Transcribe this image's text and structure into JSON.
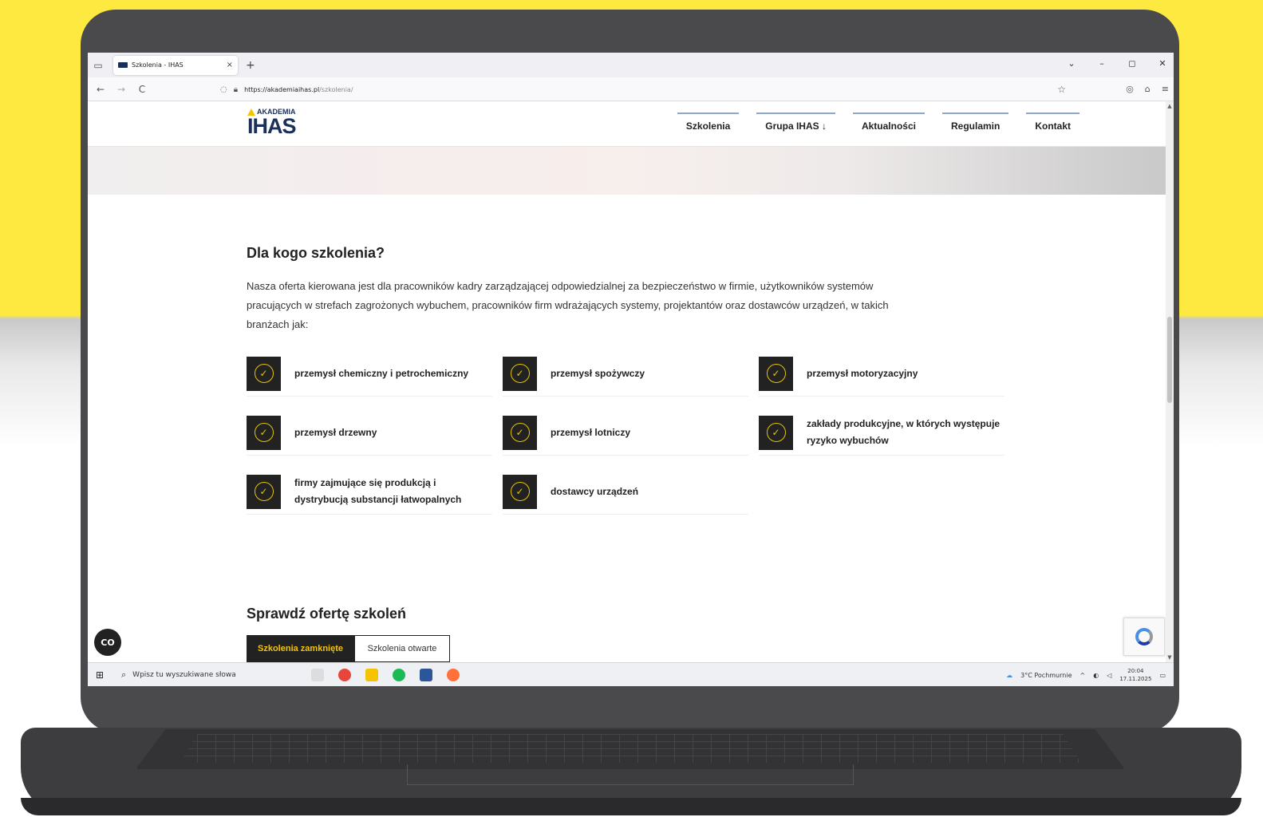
{
  "browser": {
    "tab_title": "Szkolenia - IHAS",
    "tab_close": "×",
    "new_tab": "+",
    "url_host": "https://akademiaihas.pl",
    "url_path": "/szkolenia/",
    "back": "←",
    "forward": "→",
    "reload": "C",
    "bookmark_icon": "☆",
    "window_controls": [
      "⌄",
      "–",
      "◻",
      "✕"
    ]
  },
  "site": {
    "logo_top": "AKADEMIA",
    "logo_main": "IHAS",
    "menu": [
      "Szkolenia",
      "Grupa IHAS ↓",
      "Aktualności",
      "Regulamin",
      "Kontakt"
    ]
  },
  "audience": {
    "title": "Dla kogo szkolenia?",
    "intro": "Nasza oferta kierowana jest dla pracowników kadry zarządzającej odpowiedzialnej za bezpieczeństwo w firmie, użytkowników systemów pracujących w strefach zagrożonych wybuchem, pracowników firm wdrażających systemy, projektantów oraz dostawców urządzeń, w takich branżach jak:",
    "items": [
      "przemysł chemiczny i petrochemiczny",
      "przemysł spożywczy",
      "przemysł motoryzacyjny",
      "przemysł drzewny",
      "przemysł lotniczy",
      "zakłady produkcyjne, w których występuje ryzyko wybuchów",
      "firmy zajmujące się produkcją i dystrybucją substancji łatwopalnych",
      "dostawcy urządzeń"
    ]
  },
  "offer": {
    "title": "Sprawdź ofertę szkoleń",
    "tab_closed": "Szkolenia zamknięte",
    "tab_open": "Szkolenia otwarte"
  },
  "widgets": {
    "cc_label": "CO"
  },
  "taskbar": {
    "search_placeholder": "Wpisz tu wyszukiwane słowa",
    "weather": "3°C Pochmurnie",
    "time": "20:04",
    "date": "17.11.2025"
  },
  "colors": {
    "accent": "#f5c400",
    "dark": "#222222",
    "brand_navy": "#1b2f5b",
    "background_yellow": "#fde93f"
  }
}
